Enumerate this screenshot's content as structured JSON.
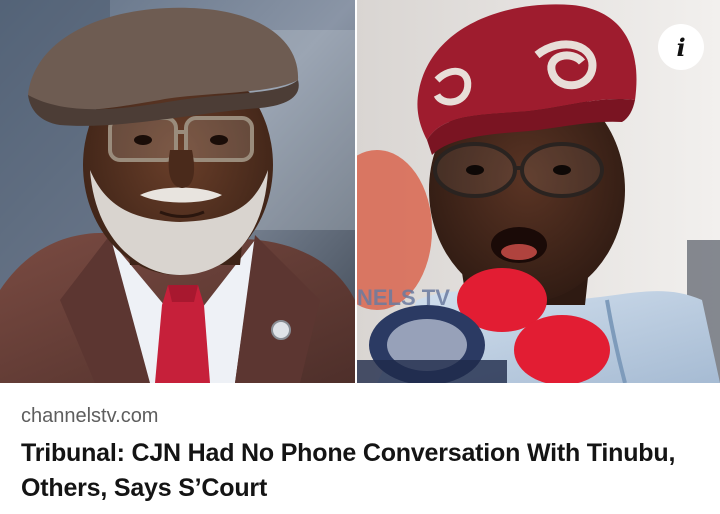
{
  "card": {
    "source": "channelstv.com",
    "headline": "Tribunal: CJN Had No Phone Conversation With Tinubu, Others, Says S’Court",
    "info_icon_glyph": "i",
    "watermark": "NELS TV"
  },
  "images": {
    "left": {
      "subject": "cjn-portrait"
    },
    "right": {
      "subject": "tinubu-speaking-portrait"
    }
  },
  "colors": {
    "background": "#ffffff",
    "source_text": "#5e5e5e",
    "headline_text": "#141414",
    "tie_red": "#c6203a",
    "cap_red": "#9e1c2e",
    "mic_red": "#e21d33"
  }
}
